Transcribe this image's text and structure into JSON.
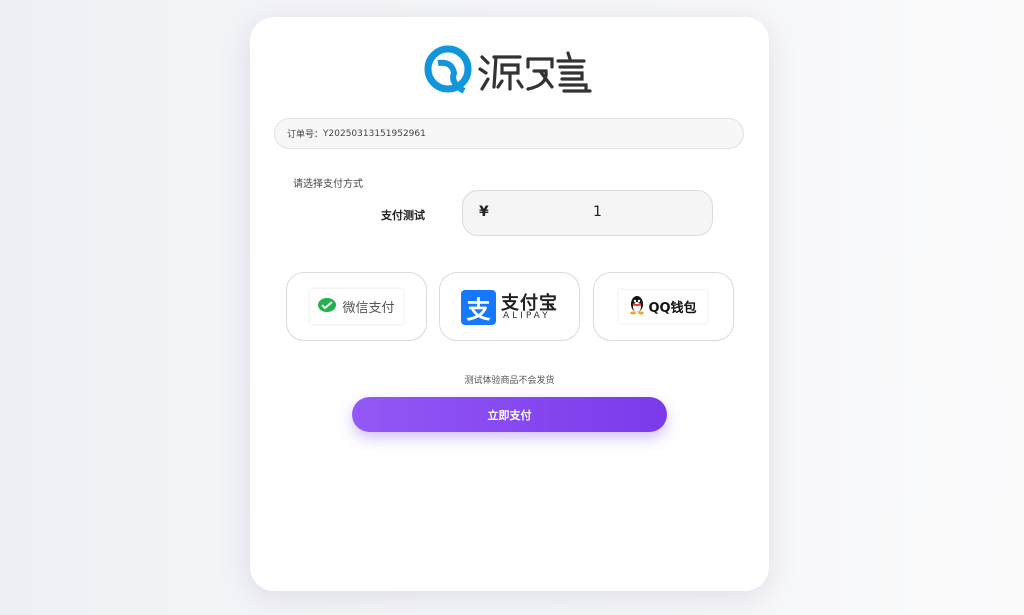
{
  "brand": {
    "logo_text": "源码字"
  },
  "order": {
    "label": "订单号：",
    "number": "Y20250313151952961"
  },
  "payment": {
    "choose_label": "请选择支付方式",
    "item_name": "支付测试",
    "currency_symbol": "¥",
    "amount": "1",
    "methods": [
      {
        "name": "微信支付",
        "icon": "wechat-icon"
      },
      {
        "name": "支付宝",
        "sub": "ALIPAY",
        "icon": "alipay-icon"
      },
      {
        "name": "QQ钱包",
        "icon": "qq-icon"
      }
    ],
    "notice": "测试体验商品不会发货",
    "submit_label": "立即支付"
  },
  "colors": {
    "accent": "#8a4ef2",
    "alipay": "#1677ff",
    "wechat": "#22b14c",
    "logo_blue": "#1296db"
  }
}
